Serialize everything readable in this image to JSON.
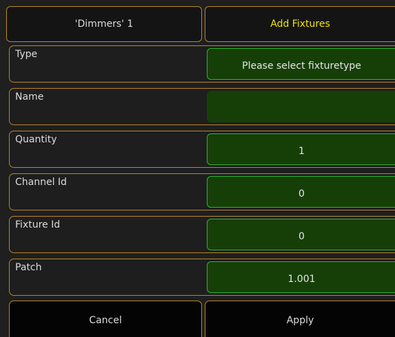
{
  "tabs": {
    "left": "'Dimmers' 1",
    "right": "Add Fixtures"
  },
  "rows": {
    "type": {
      "label": "Type",
      "value": "Please select fixturetype"
    },
    "name": {
      "label": "Name",
      "value": ""
    },
    "quantity": {
      "label": "Quantity",
      "value": "1"
    },
    "channel_id": {
      "label": "Channel Id",
      "value": "0"
    },
    "fixture_id": {
      "label": "Fixture Id",
      "value": "0"
    },
    "patch": {
      "label": "Patch",
      "value": "1.001"
    }
  },
  "buttons": {
    "cancel": "Cancel",
    "apply": "Apply"
  },
  "colors": {
    "accent_border": "#b8862a",
    "field_bg": "#163f08",
    "field_border": "#2fb52f",
    "title_text": "#f2e600"
  }
}
